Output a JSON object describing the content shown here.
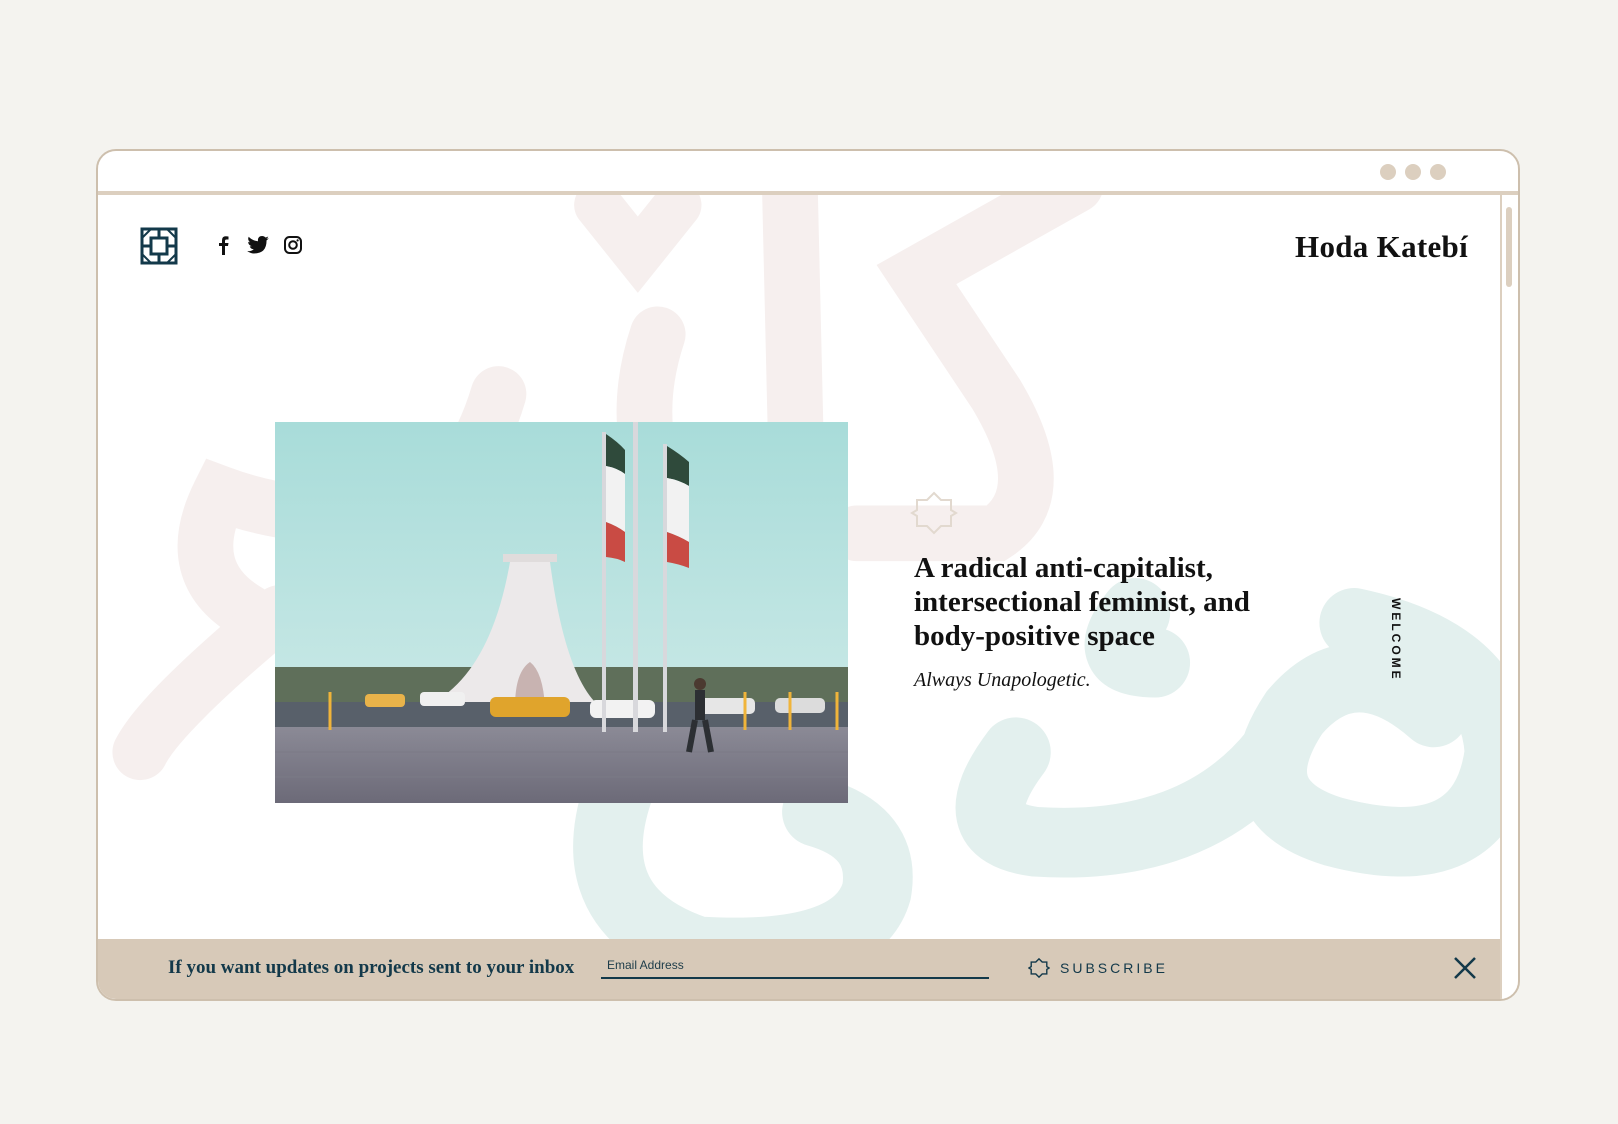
{
  "window": {
    "controls": [
      "dot",
      "dot",
      "dot"
    ]
  },
  "header": {
    "logo_icon": "geometric-knot-logo",
    "social": [
      {
        "name": "facebook",
        "glyph": "f"
      },
      {
        "name": "twitter",
        "glyph": "twitter-bird"
      },
      {
        "name": "instagram",
        "glyph": "instagram-camera"
      }
    ],
    "brand": "Hoda Katebí"
  },
  "hero": {
    "image_description": "Azadi Tower with flags",
    "headline": "A radical anti-capitalist, intersectional feminist, and body-positive space",
    "tagline": "Always Unapologetic.",
    "side_label": "WELCOME"
  },
  "subscribe": {
    "prompt": "If you want updates on projects sent to your inbox",
    "email_placeholder": "Email Address",
    "button_label": "SUBSCRIBE"
  },
  "colors": {
    "background": "#f4f3ef",
    "accent_tan": "#d7c9b8",
    "navy": "#13394a",
    "pink_calligraphy": "#f6efee",
    "teal_calligraphy": "#e3f0ee"
  }
}
